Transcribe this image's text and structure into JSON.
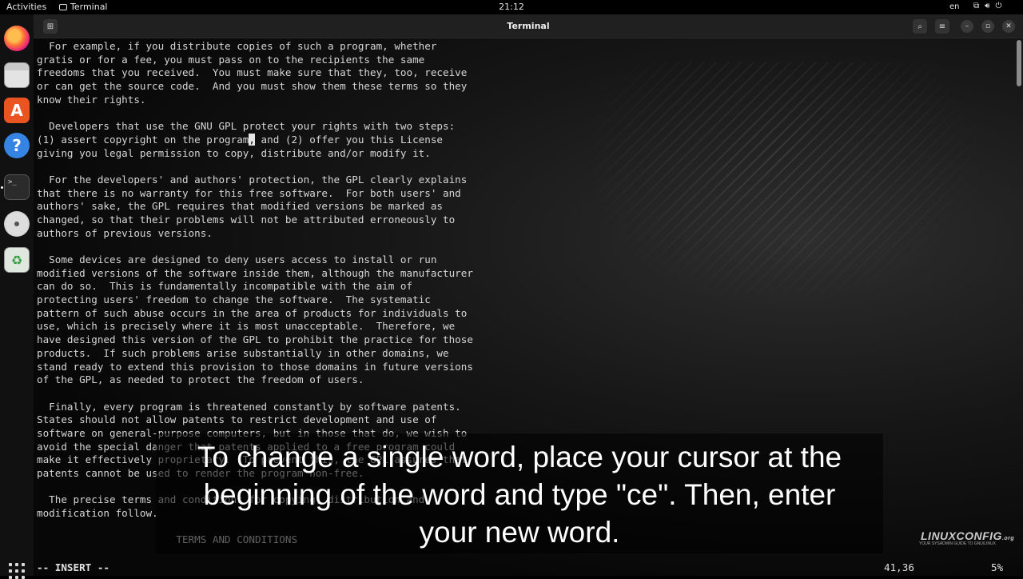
{
  "topbar": {
    "activities": "Activities",
    "app_name": "Terminal",
    "clock": "21:12",
    "lang": "en",
    "network_icon": "network-icon",
    "volume_icon": "volume-icon",
    "power_icon": "power-icon"
  },
  "dock": {
    "items": [
      "firefox-icon",
      "files-icon",
      "software-icon",
      "help-icon",
      "terminal-icon",
      "disc-icon",
      "trash-icon"
    ],
    "terminal_glyph": ">_",
    "software_glyph": "A",
    "help_glyph": "?",
    "trash_glyph": "♻"
  },
  "window": {
    "title": "Terminal"
  },
  "terminal": {
    "lines": [
      "  For example, if you distribute copies of such a program, whether",
      "gratis or for a fee, you must pass on to the recipients the same",
      "freedoms that you received.  You must make sure that they, too, receive",
      "or can get the source code.  And you must show them these terms so they",
      "know their rights.",
      "",
      "  Developers that use the GNU GPL protect your rights with two steps:",
      "",
      "giving you legal permission to copy, distribute and/or modify it.",
      "",
      "  For the developers' and authors' protection, the GPL clearly explains",
      "that there is no warranty for this free software.  For both users' and",
      "authors' sake, the GPL requires that modified versions be marked as",
      "changed, so that their problems will not be attributed erroneously to",
      "authors of previous versions.",
      "",
      "  Some devices are designed to deny users access to install or run",
      "modified versions of the software inside them, although the manufacturer",
      "can do so.  This is fundamentally incompatible with the aim of",
      "protecting users' freedom to change the software.  The systematic",
      "pattern of such abuse occurs in the area of products for individuals to",
      "use, which is precisely where it is most unacceptable.  Therefore, we",
      "have designed this version of the GPL to prohibit the practice for those",
      "products.  If such problems arise substantially in other domains, we",
      "stand ready to extend this provision to those domains in future versions",
      "of the GPL, as needed to protect the freedom of users.",
      "",
      "  Finally, every program is threatened constantly by software patents.",
      "States should not allow patents to restrict development and use of",
      "software on general-purpose computers, but in those that do, we wish to",
      "avoid the special danger that patents applied to a free program could",
      "make it effectively proprietary.  To prevent this, the GPL assures that",
      "patents cannot be used to render the program non-free.",
      "",
      "  The precise terms and conditions for copying, distribution and",
      "modification follow.",
      "",
      "                       TERMS AND CONDITIONS"
    ],
    "cursor_line": {
      "before": "(1) assert copyright on the program",
      "cursor_char": ",",
      "after": " and (2) offer you this License"
    },
    "status_mode": "-- INSERT --",
    "status_position": "41,36",
    "status_percent": "5%"
  },
  "caption": {
    "line1": "To change a single word, place your cursor at the",
    "line2": "beginning of the word and type \"ce\". Then, enter",
    "line3": "your new word."
  },
  "watermark": {
    "brand": "LINUXCONFIG",
    "suffix": ".org",
    "tagline": "YOUR SYSADMIN GUIDE TO GNU/LINUX"
  },
  "colors": {
    "topbar": "#000000",
    "dock": "#111111",
    "titlebar": "#202020",
    "terminal_text": "#d6d6d6",
    "ubuntu_orange": "#e95420"
  }
}
